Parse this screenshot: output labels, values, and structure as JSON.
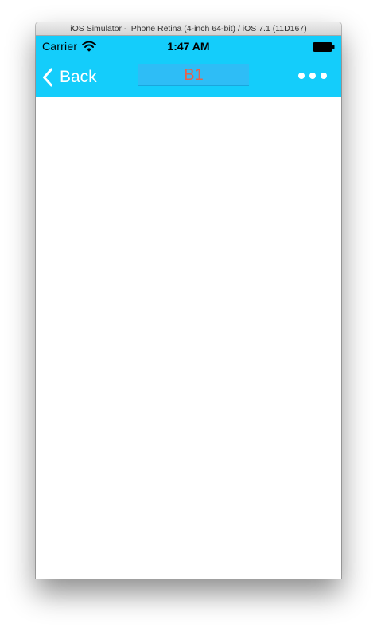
{
  "simulator": {
    "window_title": "iOS Simulator - iPhone Retina (4-inch 64-bit) / iOS 7.1 (11D167)"
  },
  "status_bar": {
    "carrier": "Carrier",
    "time": "1:47 AM",
    "wifi_icon": "wifi-icon",
    "battery_icon": "battery-icon"
  },
  "nav_bar": {
    "back_label": "Back",
    "back_icon": "chevron-left-icon",
    "title": "B1",
    "more_icon": "more-dots-icon",
    "background_color": "#14cdfb",
    "title_button_color": "#2ebdf6",
    "title_text_color": "#e8614a"
  }
}
